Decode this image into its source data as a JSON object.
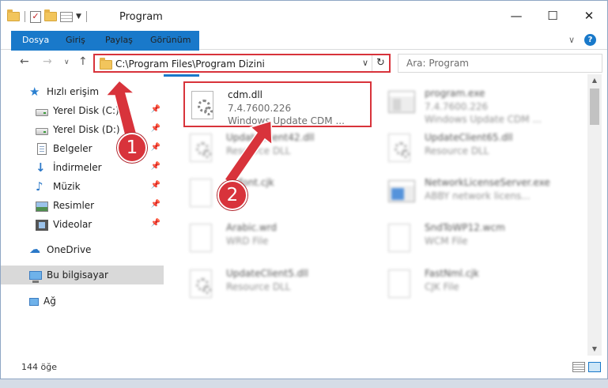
{
  "window": {
    "title": "Program",
    "controls": {
      "minimize": "—",
      "maximize": "☐",
      "close": "✕"
    }
  },
  "ribbon": {
    "tabs": [
      "Dosya",
      "Giriş",
      "Paylaş",
      "Görünüm"
    ],
    "help": "?"
  },
  "address": {
    "path": "C:\\Program Files\\Program Dizini",
    "search_placeholder": "Ara: Program"
  },
  "sidebar": {
    "items": [
      {
        "label": "Hızlı erişim",
        "icon": "star-icon"
      },
      {
        "label": "Yerel Disk (C:)",
        "icon": "drive-icon",
        "pinned": true
      },
      {
        "label": "Yerel Disk (D:)",
        "icon": "drive-icon",
        "pinned": true
      },
      {
        "label": "Belgeler",
        "icon": "documents-icon",
        "pinned": true
      },
      {
        "label": "İndirmeler",
        "icon": "download-icon",
        "pinned": true
      },
      {
        "label": "Müzik",
        "icon": "music-icon",
        "pinned": true
      },
      {
        "label": "Resimler",
        "icon": "pictures-icon",
        "pinned": true
      },
      {
        "label": "Videolar",
        "icon": "videos-icon",
        "pinned": true
      },
      {
        "label": "OneDrive",
        "icon": "onedrive-icon"
      },
      {
        "label": "Bu bilgisayar",
        "icon": "this-pc-icon",
        "selected": true
      },
      {
        "label": "Ağ",
        "icon": "network-icon"
      }
    ]
  },
  "files": [
    {
      "name": "cdm.dll",
      "line2": "7.4.7600.226",
      "line3": "Windows Update CDM ...",
      "icon": "dll-gear-icon",
      "highlighted": true
    },
    {
      "name": "program.exe",
      "line2": "7.4.7600.226",
      "line3": "Windows Update CDM ...",
      "icon": "exe-icon"
    },
    {
      "name": "UpdateClient42.dll",
      "line2": "Resource DLL",
      "icon": "dll-gear-icon"
    },
    {
      "name": "UpdateClient65.dll",
      "line2": "Resource DLL",
      "icon": "dll-gear-icon"
    },
    {
      "name": "...tfont.cjk",
      "line2": "",
      "icon": "file-icon"
    },
    {
      "name": "NetworkLicenseServer.exe",
      "line2": "ABBY network licens...",
      "icon": "exe-icon"
    },
    {
      "name": "Arabic.wrd",
      "line2": "WRD File",
      "icon": "file-icon"
    },
    {
      "name": "SndToWP12.wcm",
      "line2": "WCM File",
      "icon": "file-icon"
    },
    {
      "name": "UpdateClient5.dll",
      "line2": "Resource DLL",
      "icon": "dll-gear-icon"
    },
    {
      "name": "FastNml.cjk",
      "line2": "CJK File",
      "icon": "file-icon"
    }
  ],
  "callouts": [
    "1",
    "2"
  ],
  "status": {
    "count": "144 öğe"
  },
  "colors": {
    "accent": "#1979ca",
    "highlight": "#d8333b",
    "selection": "#d9d9d9"
  }
}
